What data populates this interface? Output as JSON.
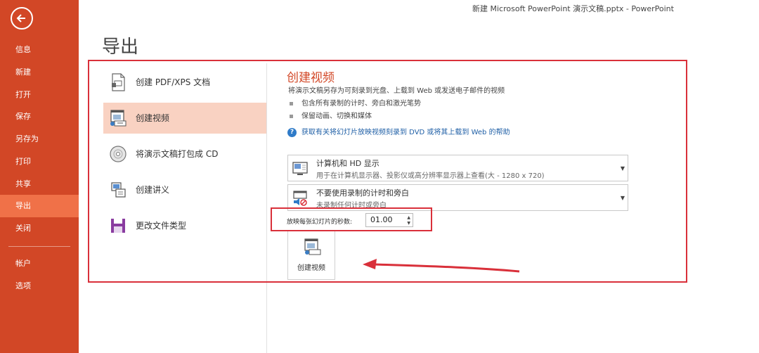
{
  "window_title": "新建 Microsoft PowerPoint 演示文稿.pptx - PowerPoint",
  "page_title": "导出",
  "sidebar": {
    "items": [
      {
        "label": "信息"
      },
      {
        "label": "新建"
      },
      {
        "label": "打开"
      },
      {
        "label": "保存"
      },
      {
        "label": "另存为"
      },
      {
        "label": "打印"
      },
      {
        "label": "共享"
      },
      {
        "label": "导出",
        "active": true
      },
      {
        "label": "关闭"
      },
      {
        "label": "帐户"
      },
      {
        "label": "选项"
      }
    ]
  },
  "export_options": [
    {
      "label": "创建 PDF/XPS 文档",
      "icon": "pdf-document-icon"
    },
    {
      "label": "创建视频",
      "icon": "video-icon",
      "active": true
    },
    {
      "label": "将演示文稿打包成 CD",
      "icon": "cd-icon"
    },
    {
      "label": "创建讲义",
      "icon": "handout-icon"
    },
    {
      "label": "更改文件类型",
      "icon": "save-file-icon"
    }
  ],
  "detail": {
    "heading": "创建视频",
    "description": "将演示文稿另存为可刻录到光盘、上载到 Web 或发送电子邮件的视频",
    "bullets": [
      "包含所有录制的计时、旁白和激光笔势",
      "保留动画、切换和媒体"
    ],
    "help_text": "获取有关将幻灯片放映视频刻录到 DVD 或将其上载到 Web 的帮助",
    "quality_dropdown": {
      "title": "计算机和 HD 显示",
      "subtitle": "用于在计算机显示器、投影仪或高分辨率显示器上查看(大 - 1280 x 720)"
    },
    "timing_dropdown": {
      "title": "不要使用录制的计时和旁白",
      "subtitle": "未录制任何计时或旁白"
    },
    "seconds_label": "放映每张幻灯片的秒数:",
    "seconds_value": "01.00",
    "create_button_label": "创建视频"
  },
  "colors": {
    "accent": "#d24726",
    "sidebar_active": "#f07148",
    "option_active": "#f9d2c2",
    "annotation_red": "#d9303a"
  }
}
